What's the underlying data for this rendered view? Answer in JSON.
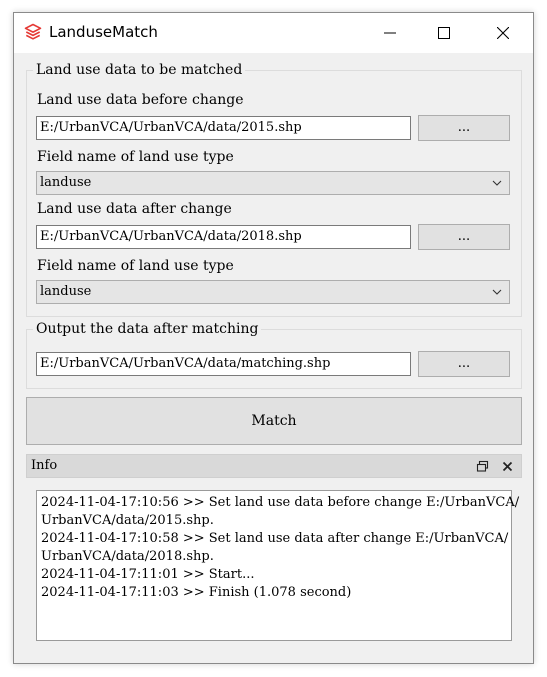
{
  "window": {
    "title": "LanduseMatch",
    "icon": "stacked-layers-icon",
    "controls": [
      "minimize-icon",
      "maximize-icon",
      "close-icon"
    ]
  },
  "input_group": {
    "legend": "Land use data to be matched",
    "before": {
      "label": "Land use data before change",
      "path": "E:/UrbanVCA/UrbanVCA/data/2015.shp",
      "browse_label": "...",
      "field_label": "Field name of land use type",
      "field_value": "landuse"
    },
    "after": {
      "label": "Land use data after change",
      "path": "E:/UrbanVCA/UrbanVCA/data/2018.shp",
      "browse_label": "...",
      "field_label": "Field name of land use type",
      "field_value": "landuse"
    }
  },
  "output_group": {
    "legend": "Output the data after matching",
    "path": "E:/UrbanVCA/UrbanVCA/data/matching.shp",
    "browse_label": "..."
  },
  "match_button": {
    "label": "Match"
  },
  "info": {
    "title": "Info",
    "log_lines": [
      "2024-11-04-17:10:56 >> Set land use data before change E:/UrbanVCA/",
      "UrbanVCA/data/2015.shp.",
      "2024-11-04-17:10:58 >> Set land use data after change E:/UrbanVCA/",
      "UrbanVCA/data/2018.shp.",
      "2024-11-04-17:11:01 >> Start...",
      "2024-11-04-17:11:03 >> Finish (1.078 second)"
    ]
  },
  "colors": {
    "window_bg": "#f0f0f0",
    "icon_red": "#e53935",
    "button_bg": "#e1e1e1",
    "info_header_bg": "#d9d9d9"
  }
}
